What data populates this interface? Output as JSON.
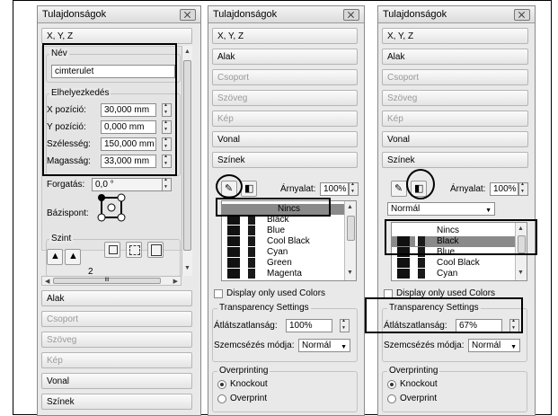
{
  "panel_title": "Tulajdonságok",
  "p1": {
    "xyz": "X, Y, Z",
    "nev_title": "Név",
    "nev_value": "cimterulet",
    "elhelyezkedes_title": "Elhelyezkedés",
    "fields": [
      {
        "label": "X pozíció:",
        "value": "30,000 mm"
      },
      {
        "label": "Y pozíció:",
        "value": "0,000 mm"
      },
      {
        "label": "Szélesség:",
        "value": "150,000 mm"
      },
      {
        "label": "Magasság:",
        "value": "33,000 mm"
      }
    ],
    "forgatas_label": "Forgatás:",
    "forgatas_value": "0,0 °",
    "bazispont_label": "Bázispont:",
    "szint_label": "Szint",
    "szint_value": "2",
    "scroll_mid": "III",
    "sections": [
      "Alak",
      "Csoport",
      "Szöveg",
      "Kép",
      "Vonal",
      "Színek"
    ]
  },
  "p2": {
    "sections": [
      "X, Y, Z",
      "Alak",
      "Csoport",
      "Szöveg",
      "Kép",
      "Vonal",
      "Színek"
    ],
    "arnyalat_label": "Árnyalat:",
    "arnyalat_value": "100%",
    "colors": [
      "Nincs",
      "Black",
      "Blue",
      "Cool Black",
      "Cyan",
      "Green",
      "Magenta"
    ],
    "display_only": "Display only used Colors",
    "transparency_title": "Transparency Settings",
    "atlatszo_label": "Átlátszatlanság:",
    "atlatszo_value": "100%",
    "szemcsezes_label": "Szemcsézés módja:",
    "szemcsezes_value": "Normál",
    "overprinting_title": "Overprinting",
    "knockout": "Knockout",
    "overprint": "Overprint"
  },
  "p3": {
    "sections": [
      "X, Y, Z",
      "Alak",
      "Csoport",
      "Szöveg",
      "Kép",
      "Vonal",
      "Színek"
    ],
    "arnyalat_label": "Árnyalat:",
    "arnyalat_value": "100%",
    "blend_value": "Normál",
    "colors": [
      "Nincs",
      "Black",
      "Blue",
      "Cool Black",
      "Cyan"
    ],
    "display_only": "Display only used Colors",
    "transparency_title": "Transparency Settings",
    "atlatszo_label": "Átlátszatlanság:",
    "atlatszo_value": "67%",
    "szemcsezes_label": "Szemcsézés módja:",
    "szemcsezes_value": "Normál",
    "overprinting_title": "Overprinting",
    "knockout": "Knockout",
    "overprint": "Overprint"
  }
}
